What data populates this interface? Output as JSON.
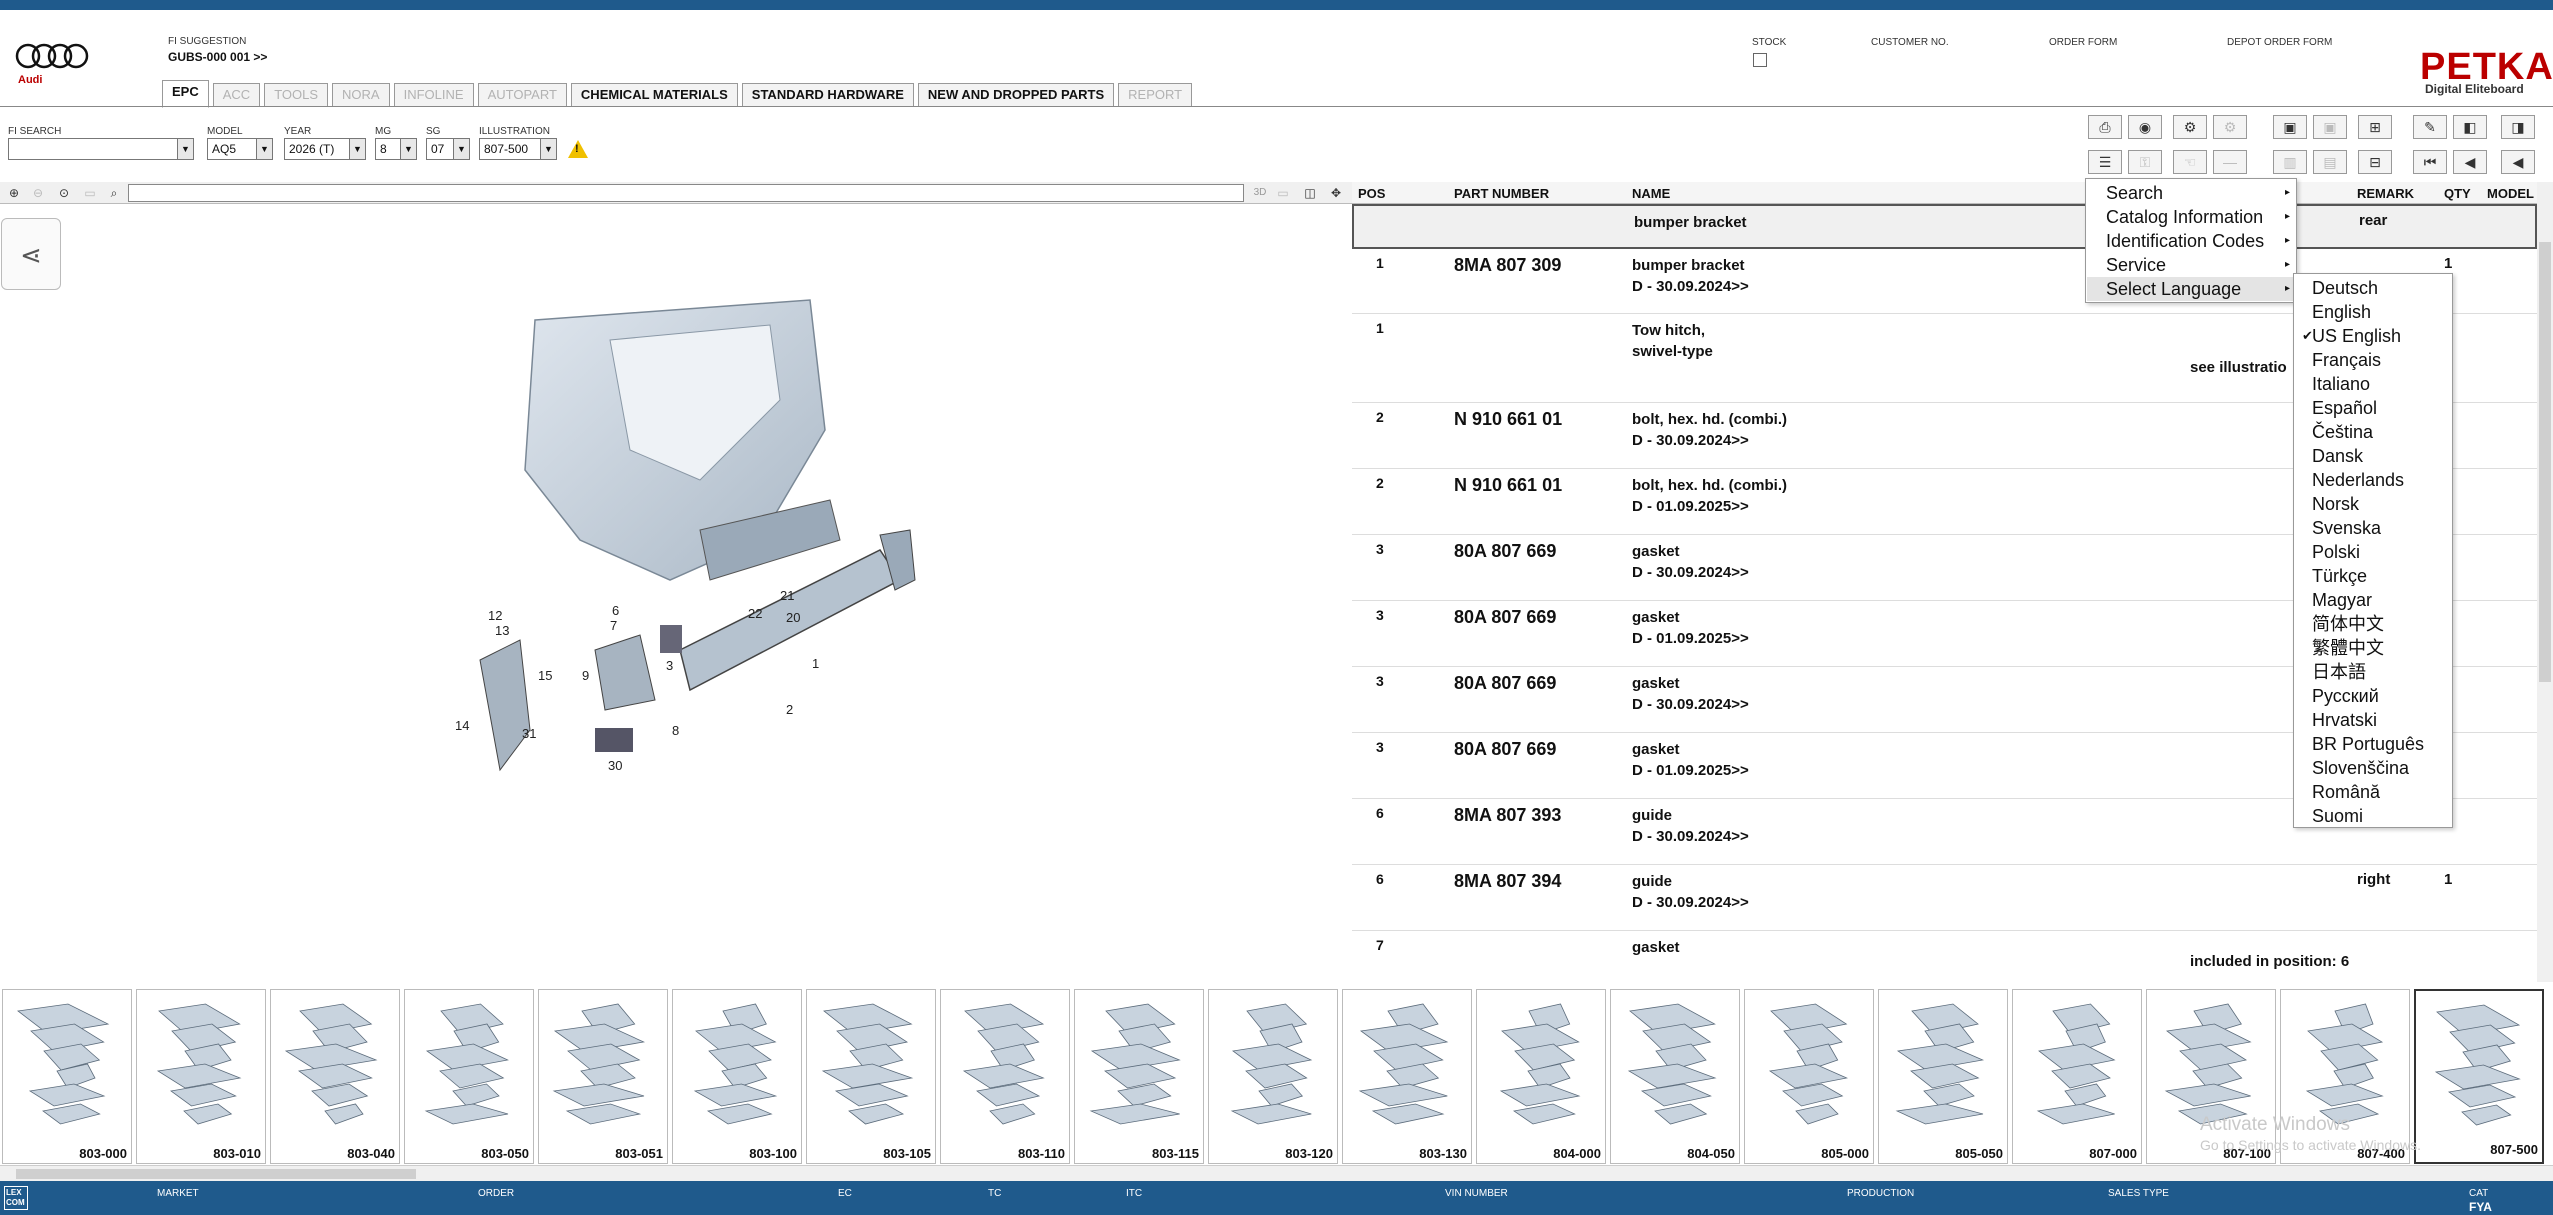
{
  "brand": {
    "logo_text": "Audi",
    "app_name": "PETKA",
    "app_sub": "Digital Eliteboard"
  },
  "header": {
    "fi_suggestion_label": "FI SUGGESTION",
    "fi_suggestion_value": "GUBS-000 001 >>",
    "stock_label": "STOCK",
    "customer_label": "CUSTOMER NO.",
    "order_form_label": "ORDER FORM",
    "depot_label": "DEPOT ORDER FORM"
  },
  "tabs": [
    {
      "label": "EPC",
      "state": "active"
    },
    {
      "label": "ACC",
      "state": "disabled"
    },
    {
      "label": "TOOLS",
      "state": "disabled"
    },
    {
      "label": "NORA",
      "state": "disabled"
    },
    {
      "label": "INFOLINE",
      "state": "disabled"
    },
    {
      "label": "AUTOPART",
      "state": "disabled"
    },
    {
      "label": "CHEMICAL MATERIALS",
      "state": "enabled"
    },
    {
      "label": "STANDARD HARDWARE",
      "state": "enabled"
    },
    {
      "label": "NEW AND DROPPED PARTS",
      "state": "enabled"
    },
    {
      "label": "REPORT",
      "state": "disabled"
    }
  ],
  "filters": {
    "fi_search": {
      "label": "FI SEARCH",
      "value": ""
    },
    "model": {
      "label": "MODEL",
      "value": "AQ5"
    },
    "year": {
      "label": "YEAR",
      "value": "2026 (T)"
    },
    "mg": {
      "label": "MG",
      "value": "8"
    },
    "sg": {
      "label": "SG",
      "value": "07"
    },
    "illustration": {
      "label": "ILLUSTRATION",
      "value": "807-500"
    },
    "warning_glyph": "!"
  },
  "toolbar_icons": [
    "print-icon",
    "catalog-icon",
    "tools-icon",
    "disabled-icon",
    "elsa-icon",
    "ecat-icon",
    "cart-icon",
    "pin-icon",
    "prev-page-icon",
    "next-page-icon",
    "menu-icon",
    "key-icon",
    "hand-icon",
    "minus-icon",
    "copy-icon",
    "paste-icon",
    "basket-icon",
    "first-icon",
    "prev-icon",
    "back-icon"
  ],
  "ill_toolbar": {
    "label_3d": "3D"
  },
  "table": {
    "headers": {
      "pos": "POS",
      "part_number": "PART NUMBER",
      "name": "NAME",
      "remark": "REMARK",
      "qty": "QTY",
      "model": "MODEL"
    },
    "rows": [
      {
        "pos": "",
        "pn": "",
        "name": "bumper bracket",
        "remark": "rear",
        "qty": ""
      },
      {
        "pos": "1",
        "pn": "8MA 807 309",
        "name": "bumper bracket\nD - 30.09.2024>>",
        "remark": "",
        "qty": "1"
      },
      {
        "pos": "1",
        "pn": "",
        "name": "Tow hitch,\nswivel-type",
        "remark": "",
        "qty": "",
        "extra": "see illustratio"
      },
      {
        "pos": "2",
        "pn": "N   910 661 01",
        "name": "bolt, hex. hd. (combi.)\nD - 30.09.2024>>",
        "remark": "",
        "qty": ""
      },
      {
        "pos": "2",
        "pn": "N   910 661 01",
        "name": "bolt, hex. hd. (combi.)\nD - 01.09.2025>>",
        "remark": "",
        "qty": ""
      },
      {
        "pos": "3",
        "pn": "80A 807 669",
        "name": "gasket\nD - 30.09.2024>>",
        "remark": "",
        "qty": ""
      },
      {
        "pos": "3",
        "pn": "80A 807 669",
        "name": "gasket\nD - 01.09.2025>>",
        "remark": "",
        "qty": ""
      },
      {
        "pos": "3",
        "pn": "80A 807 669",
        "name": "gasket\nD - 30.09.2024>>",
        "remark": "",
        "qty": ""
      },
      {
        "pos": "3",
        "pn": "80A 807 669",
        "name": "gasket\nD - 01.09.2025>>",
        "remark": "",
        "qty": ""
      },
      {
        "pos": "6",
        "pn": "8MA 807 393",
        "name": "guide\nD - 30.09.2024>>",
        "remark": "",
        "qty": ""
      },
      {
        "pos": "6",
        "pn": "8MA 807 394",
        "name": "guide\nD - 30.09.2024>>",
        "remark": "right",
        "qty": "1"
      },
      {
        "pos": "7",
        "pn": "",
        "name": "gasket",
        "remark": "",
        "qty": "",
        "extra": "included in position:  6"
      }
    ]
  },
  "context_menu": {
    "items": [
      "Search",
      "Catalog Information",
      "Identification Codes",
      "Service",
      "Select Language"
    ],
    "highlighted": "Select Language"
  },
  "languages": {
    "items": [
      "Deutsch",
      "English",
      "US English",
      "Français",
      "Italiano",
      "Español",
      "Čeština",
      "Dansk",
      "Nederlands",
      "Norsk",
      "Svenska",
      "Polski",
      "Türkçe",
      "Magyar",
      "简体中文",
      "繁體中文",
      "日本語",
      "Русский",
      "Hrvatski",
      "BR Português",
      "Slovenščina",
      "Română",
      "Suomi"
    ],
    "checked": "US English"
  },
  "illustration_callouts": [
    "12",
    "13",
    "14",
    "15",
    "31",
    "9",
    "8",
    "6",
    "7",
    "3",
    "30",
    "22",
    "21",
    "20",
    "1",
    "2"
  ],
  "thumbnails": [
    "803-000",
    "803-010",
    "803-040",
    "803-050",
    "803-051",
    "803-100",
    "803-105",
    "803-110",
    "803-115",
    "803-120",
    "803-130",
    "804-000",
    "804-050",
    "805-000",
    "805-050",
    "807-000",
    "807-100",
    "807-400",
    "807-500"
  ],
  "selected_thumbnail": "807-500",
  "watermark": {
    "line1": "Activate Windows",
    "line2": "Go to Settings to activate Windows."
  },
  "status_bar": {
    "logo": "LEX COM",
    "labels": [
      "MARKET",
      "ORDER",
      "EC",
      "TC",
      "ITC",
      "VIN NUMBER",
      "PRODUCTION",
      "SALES TYPE",
      "CAT"
    ],
    "cat_value": "FYA"
  }
}
